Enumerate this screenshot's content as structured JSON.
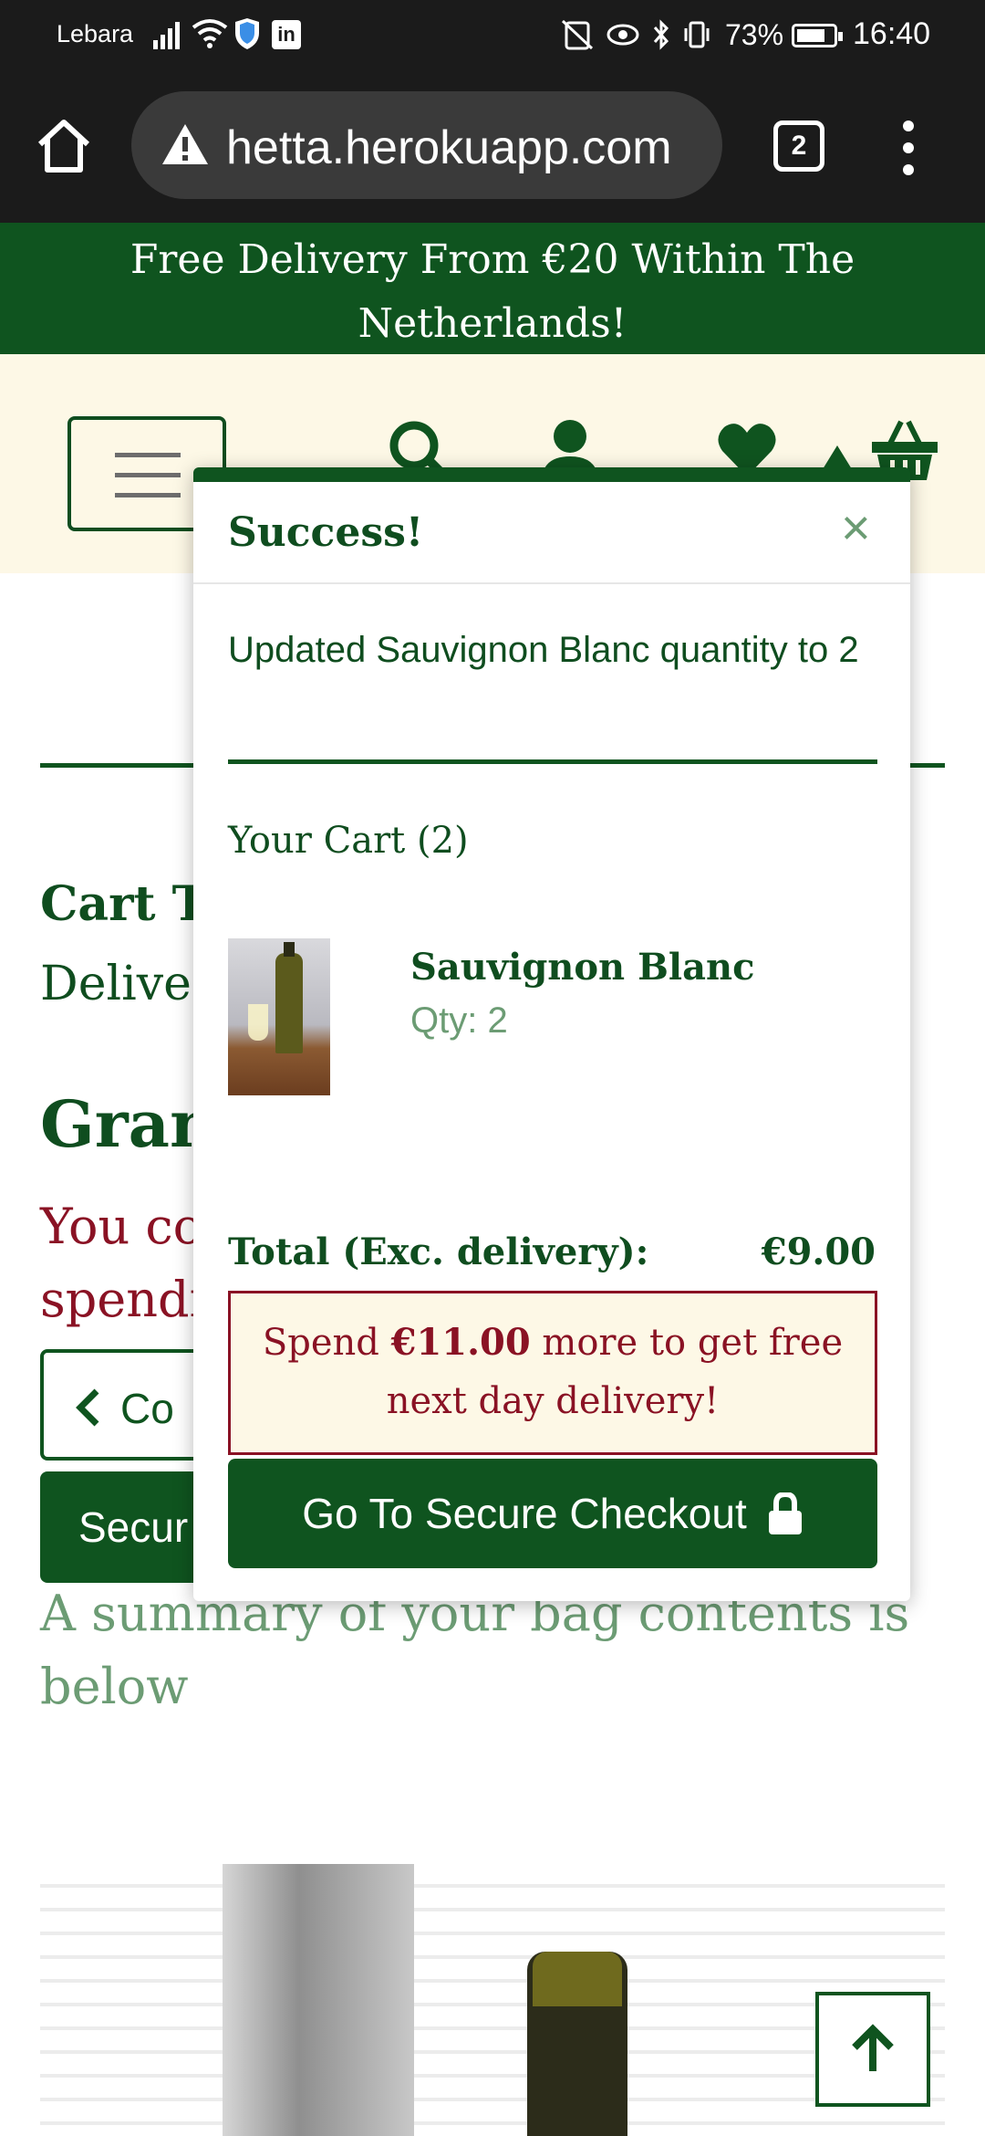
{
  "status_bar": {
    "carrier": "Lebara",
    "battery_percent": "73%",
    "time": "16:40"
  },
  "browser": {
    "url": "hetta.herokuapp.com",
    "tab_count": "2"
  },
  "banner": {
    "text": "Free Delivery From €20 Within The Netherlands!"
  },
  "page": {
    "cart_total_label": "Cart T",
    "delivery_label": "Delive",
    "grand_total_label": "Gran",
    "free_delivery_notice": "You co\nspendi",
    "continue_button": "Co",
    "secure_button": "Secur",
    "summary_text": "A summary of your bag contents is below"
  },
  "toast": {
    "title": "Success!",
    "close_glyph": "×",
    "message": "Updated Sauvignon Blanc quantity to 2",
    "cart_heading": "Your Cart (2)",
    "item": {
      "name": "Sauvignon Blanc",
      "qty": "Qty: 2"
    },
    "total_label": "Total (Exc. delivery):",
    "total_value": "€9.00",
    "spend_prefix": "Spend",
    "spend_amount": "€11.00",
    "spend_suffix": "more to get free next day delivery!",
    "checkout_button": "Go To Secure Checkout"
  },
  "colors": {
    "brand_green": "#0f541f",
    "cream": "#fdf8e6",
    "alert_red": "#8a1224",
    "muted_green": "#6c9c74"
  },
  "icons": [
    "home-icon",
    "warning-icon",
    "tabs-icon",
    "overflow-menu-icon",
    "menu-icon",
    "search-icon",
    "user-icon",
    "heart-icon",
    "basket-icon",
    "close-icon",
    "chevron-left-icon",
    "lock-icon",
    "arrow-up-icon"
  ]
}
